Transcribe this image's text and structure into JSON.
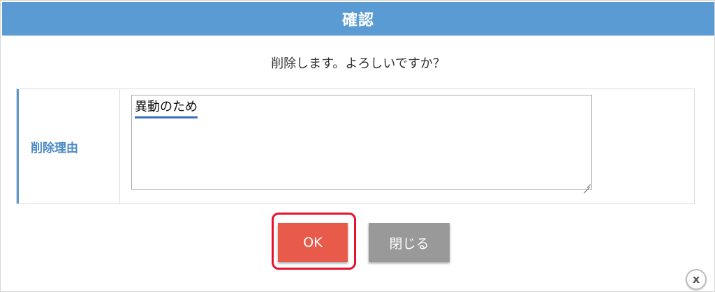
{
  "dialog": {
    "title": "確認",
    "message": "削除します。よろしいですか？"
  },
  "form": {
    "reason_label": "削除理由",
    "reason_value": "異動のため"
  },
  "buttons": {
    "ok_label": "OK",
    "close_label": "閉じる"
  },
  "close_icon": {
    "glyph": "x",
    "icon": "close-icon"
  },
  "colors": {
    "header": "#5a9bd3",
    "ok_button": "#e85a4a",
    "close_button": "#999999",
    "highlight": "#e8112d"
  }
}
